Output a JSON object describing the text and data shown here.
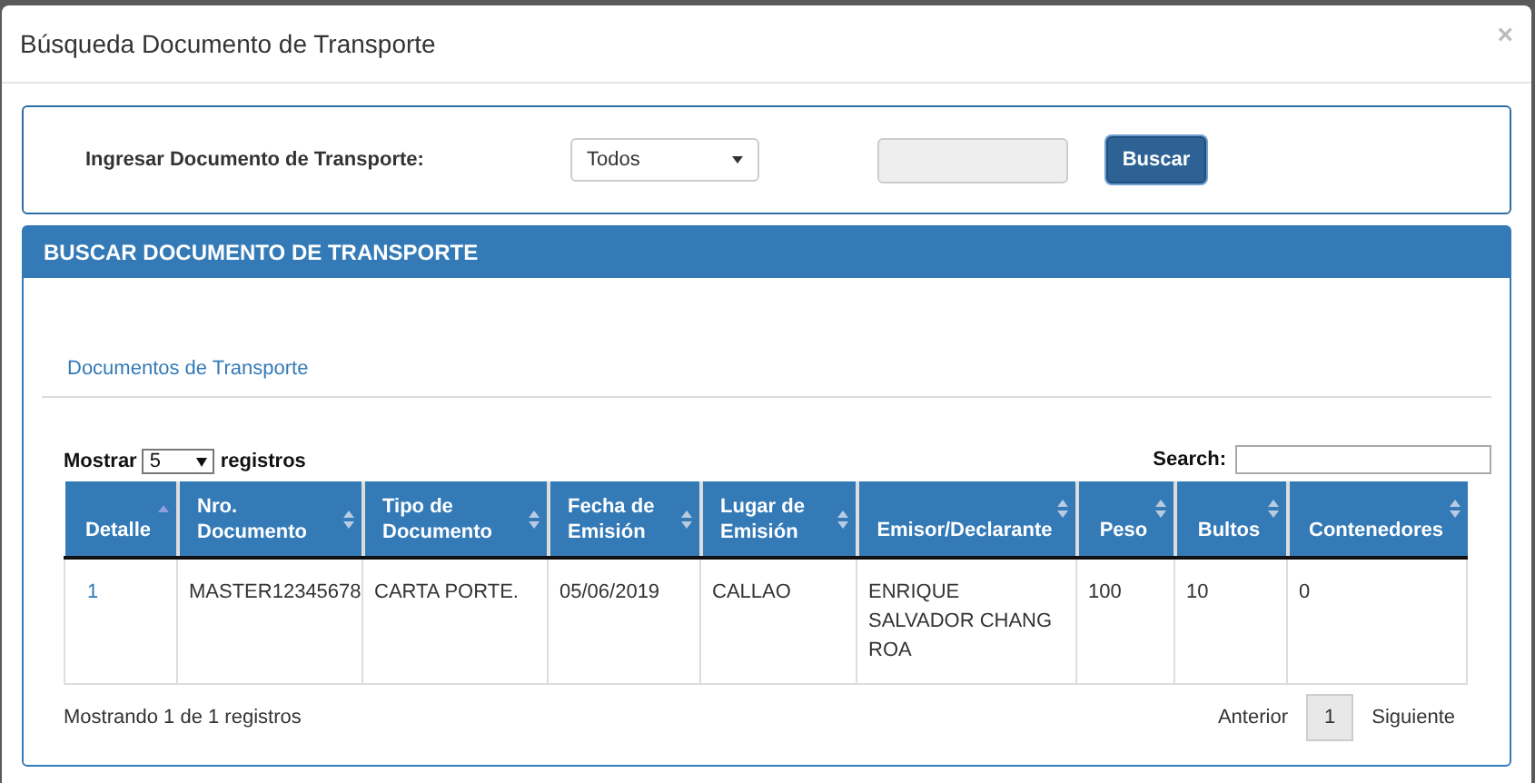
{
  "modal": {
    "title": "Búsqueda Documento de Transporte",
    "close": "×"
  },
  "search_form": {
    "label": "Ingresar Documento de Transporte:",
    "type_select": "Todos",
    "button": "Buscar"
  },
  "panel": {
    "title": "BUSCAR DOCUMENTO DE TRANSPORTE",
    "tabs": [
      {
        "label": "Documentos de Transporte",
        "selected": true
      }
    ],
    "length": {
      "before": "Mostrar",
      "value": "5",
      "after": "registros"
    },
    "filter": {
      "label": "Search:"
    },
    "table": {
      "columns": [
        {
          "label": "Detalle",
          "sorted": true
        },
        {
          "label": "Nro. Documento",
          "sorted": false
        },
        {
          "label": "Tipo de Documento",
          "sorted": false
        },
        {
          "label": "Fecha de Emisión",
          "sorted": false
        },
        {
          "label": "Lugar de Emisión",
          "sorted": false
        },
        {
          "label": "Emisor/Declarante",
          "sorted": false
        },
        {
          "label": "Peso",
          "sorted": false
        },
        {
          "label": "Bultos",
          "sorted": false
        },
        {
          "label": "Contenedores",
          "sorted": false
        }
      ],
      "rows": [
        [
          "1",
          "MASTER12345678",
          "CARTA PORTE.",
          "05/06/2019",
          "CALLAO",
          "ENRIQUE SALVADOR CHANG ROA",
          "100",
          "10",
          "0"
        ]
      ]
    },
    "info": "Mostrando 1 de 1 registros",
    "pagination": [
      {
        "label": "Anterior",
        "kind": "prev",
        "selected": false
      },
      {
        "label": "1",
        "kind": "page",
        "selected": true
      },
      {
        "label": "Siguiente",
        "kind": "next",
        "selected": false
      }
    ]
  }
}
